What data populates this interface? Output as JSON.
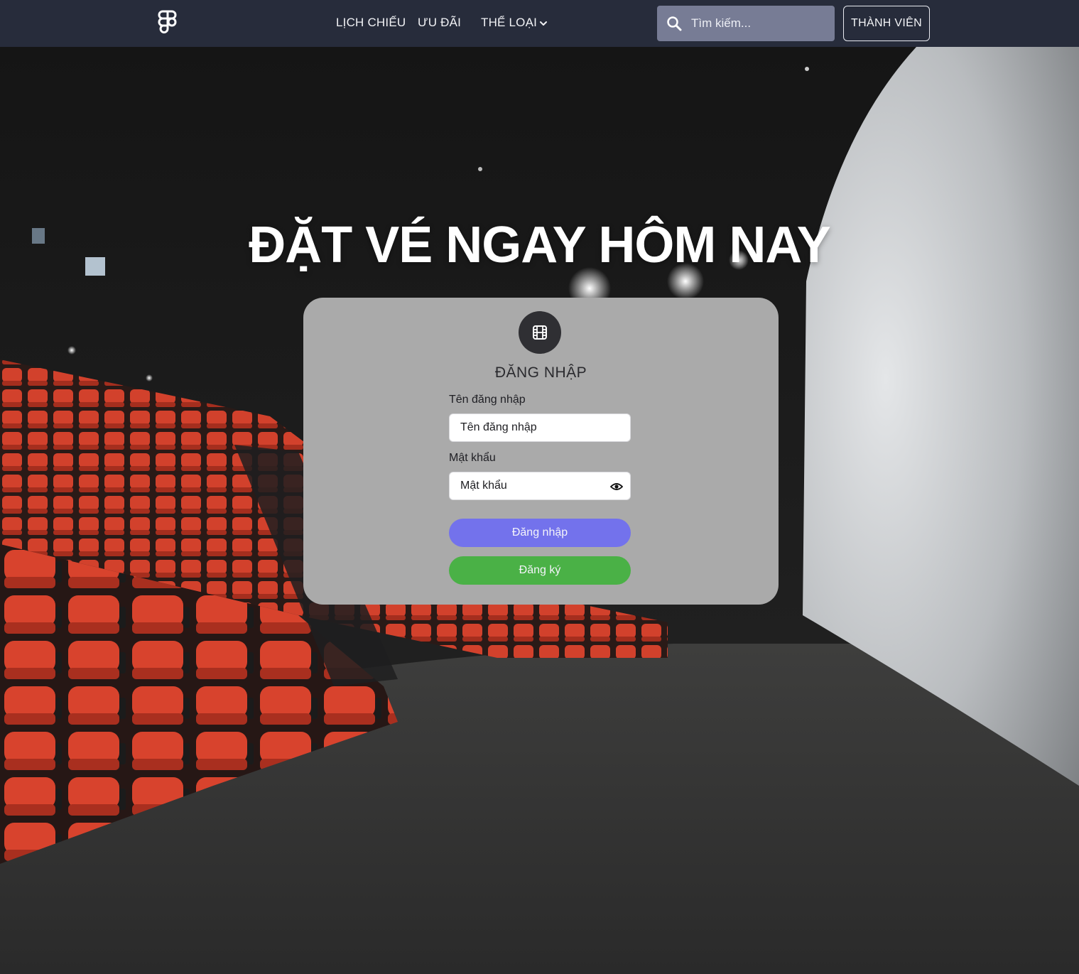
{
  "navbar": {
    "logo_icon": "figma-logo-icon",
    "links": [
      "LỊCH CHIẾU",
      "ƯU ĐÃI",
      "THỂ LOẠI"
    ],
    "genre_dropdown_icon": "chevron-down-icon",
    "search": {
      "placeholder": "Tìm kiếm...",
      "icon": "search-icon"
    },
    "member_button": "THÀNH VIÊN"
  },
  "hero": {
    "headline": "ĐẶT VÉ NGAY HÔM NAY",
    "background": "cinema-hall-photo"
  },
  "login": {
    "icon": "film-icon",
    "title": "ĐĂNG NHẬP",
    "username": {
      "label": "Tên đăng nhập",
      "placeholder": "Tên đăng nhập"
    },
    "password": {
      "label": "Mật khẩu",
      "placeholder": "Mật khẩu",
      "toggle_icon": "eye-icon"
    },
    "login_button": "Đăng nhập",
    "register_button": "Đăng ký"
  },
  "colors": {
    "navbar_bg": "#272c3b",
    "card_bg": "#aaaaaa",
    "login_button": "#7372ec",
    "register_button": "#4ab146",
    "seat_red": "#d2412c"
  }
}
